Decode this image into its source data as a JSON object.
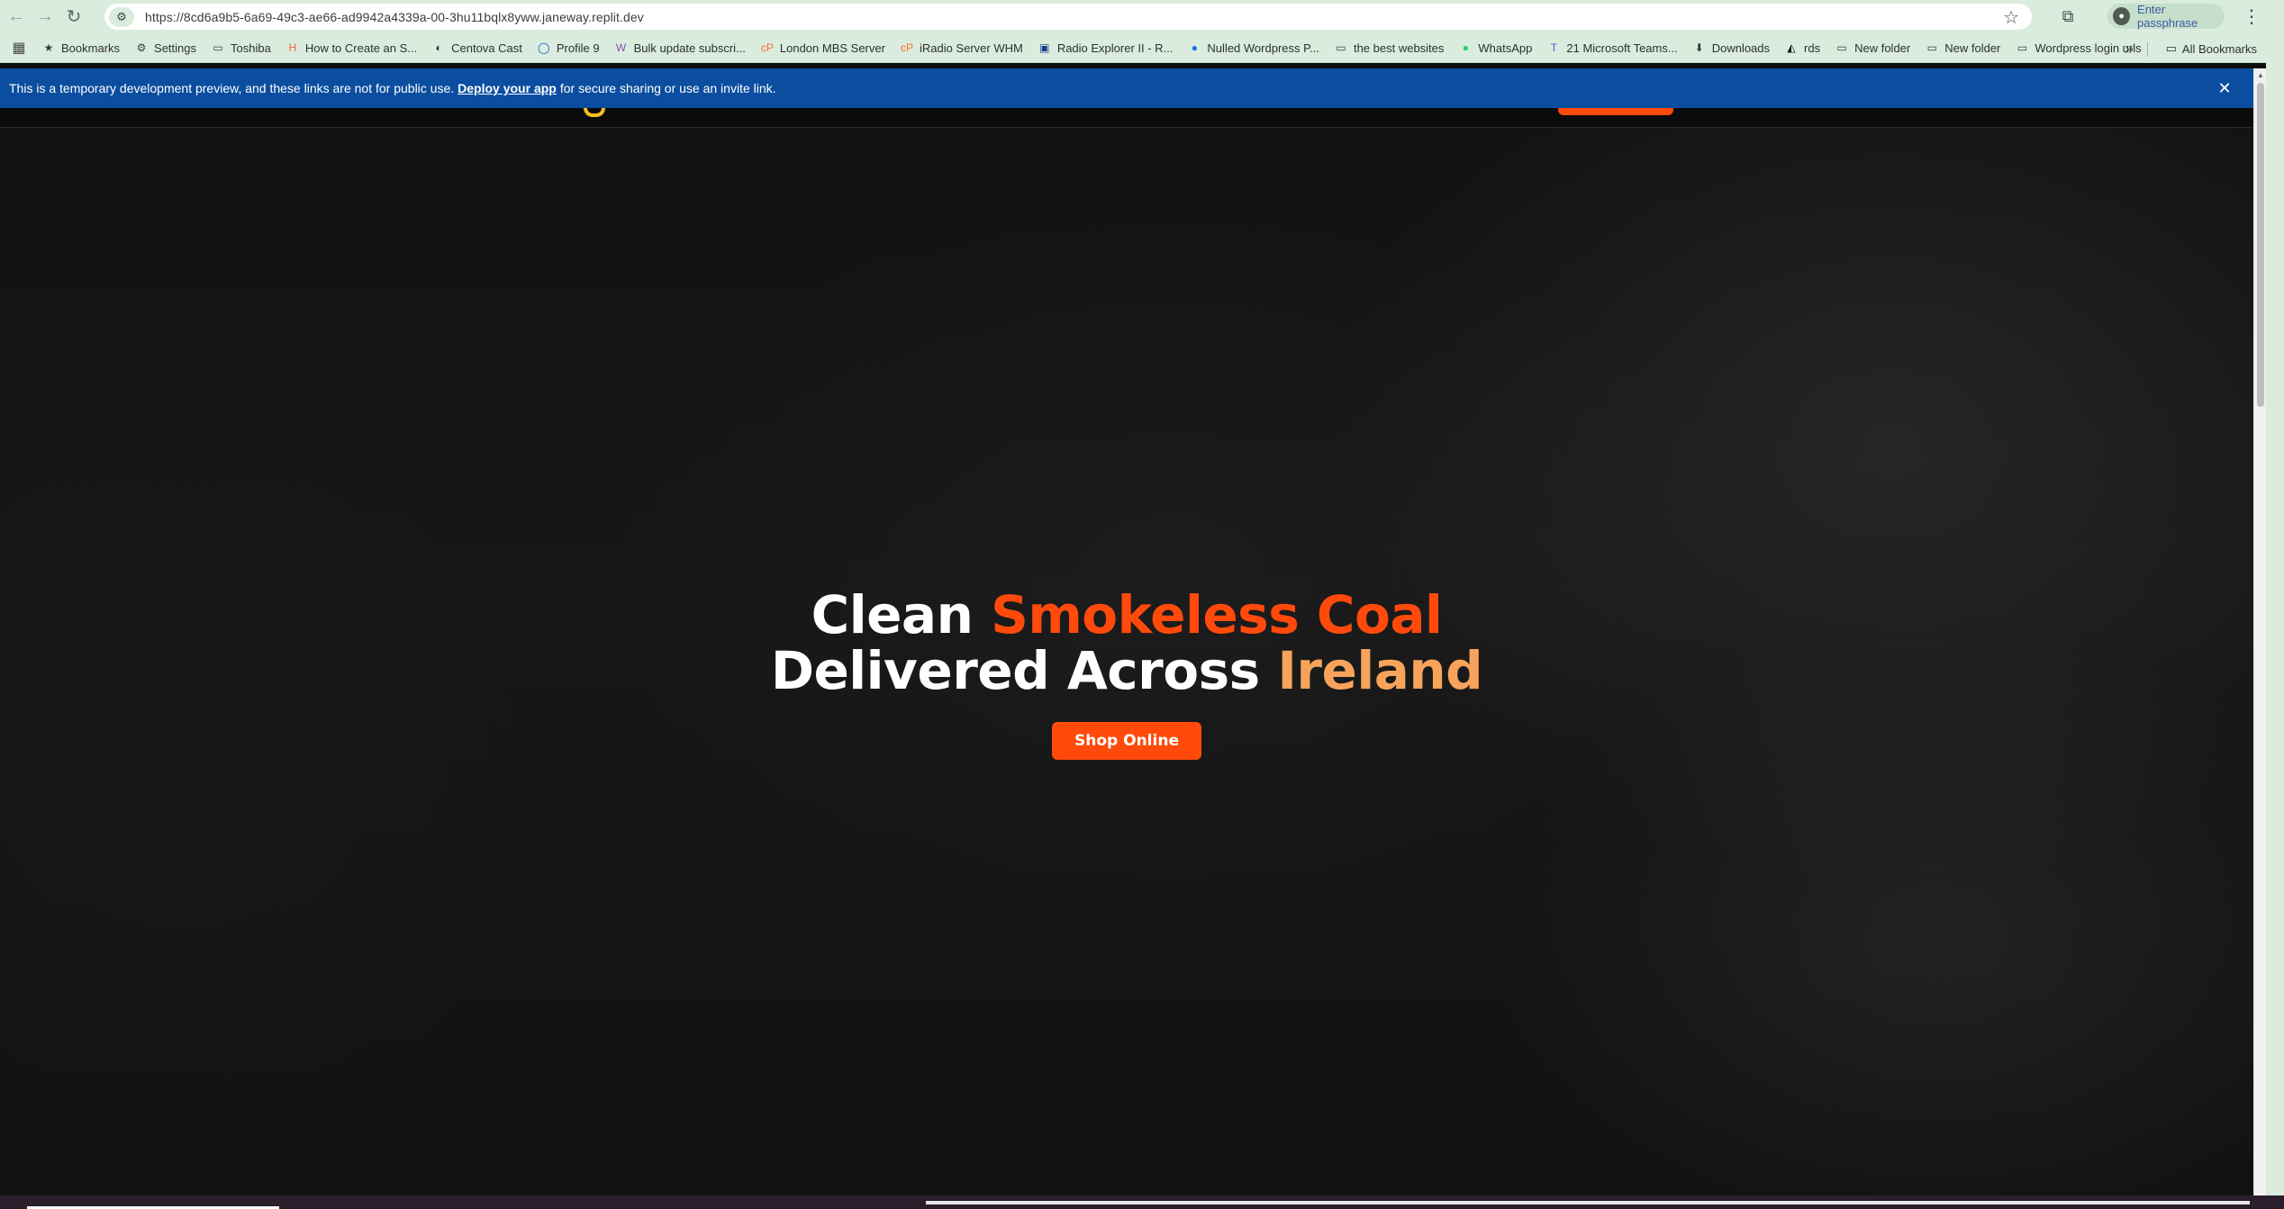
{
  "browser": {
    "url": "https://8cd6a9b5-6a69-49c3-ae66-ad9942a4339a-00-3hu11bqlx8yww.janeway.replit.dev",
    "profile_label": "Enter passphrase",
    "bookmarks": [
      {
        "label": "Bookmarks",
        "icon": "star-icon",
        "glyph": "★",
        "color": "#3a3a3a"
      },
      {
        "label": "Settings",
        "icon": "gear-icon",
        "glyph": "⚙",
        "color": "#3a3a3a"
      },
      {
        "label": "Toshiba",
        "icon": "folder-icon",
        "glyph": "▭",
        "color": "#3a3a3a"
      },
      {
        "label": "How to Create an S...",
        "icon": "hubspot-icon",
        "glyph": "H",
        "color": "#ff5c35"
      },
      {
        "label": "Centova Cast",
        "icon": "centova-icon",
        "glyph": "◐",
        "color": "#333333"
      },
      {
        "label": "Profile 9",
        "icon": "profile-icon",
        "glyph": "◯",
        "color": "#1a56db"
      },
      {
        "label": "Bulk update subscri...",
        "icon": "woo-icon",
        "glyph": "W",
        "color": "#7f54b3"
      },
      {
        "label": "London MBS Server",
        "icon": "cpanel-icon",
        "glyph": "cP",
        "color": "#ff6c2c"
      },
      {
        "label": "iRadio Server WHM",
        "icon": "cpanel-icon",
        "glyph": "cP",
        "color": "#ff6c2c"
      },
      {
        "label": "Radio Explorer II - R...",
        "icon": "radio-icon",
        "glyph": "▣",
        "color": "#1c3d8f"
      },
      {
        "label": "Nulled Wordpress P...",
        "icon": "globe-icon",
        "glyph": "●",
        "color": "#1a73e8"
      },
      {
        "label": "the best websites",
        "icon": "folder-icon",
        "glyph": "▭",
        "color": "#3a3a3a"
      },
      {
        "label": "WhatsApp",
        "icon": "whatsapp-icon",
        "glyph": "●",
        "color": "#25d366"
      },
      {
        "label": "21 Microsoft Teams...",
        "icon": "teams-icon",
        "glyph": "T",
        "color": "#5b5fc7"
      },
      {
        "label": "Downloads",
        "icon": "download-icon",
        "glyph": "⬇",
        "color": "#3a3a3a"
      },
      {
        "label": "rds",
        "icon": "rds-icon",
        "glyph": "◭",
        "color": "#111111"
      },
      {
        "label": "New folder",
        "icon": "folder-icon",
        "glyph": "▭",
        "color": "#3a3a3a"
      },
      {
        "label": "New folder",
        "icon": "folder-icon",
        "glyph": "▭",
        "color": "#3a3a3a"
      },
      {
        "label": "Wordpress login urls",
        "icon": "folder-icon",
        "glyph": "▭",
        "color": "#3a3a3a"
      }
    ],
    "all_bookmarks_label": "All Bookmarks"
  },
  "banner": {
    "text_before": "This is a temporary development preview, and these links are not for public use.",
    "link_label": "Deploy your app",
    "text_after": "for secure sharing or use an invite link.",
    "close_glyph": "✕"
  },
  "hero": {
    "title_part1": "Clean",
    "title_highlight1": "Smokeless Coal",
    "title_part2": "Delivered Across",
    "title_highlight2": "Ireland",
    "cta_label": "Shop Online"
  },
  "colors": {
    "accent_orange": "#ff4a0b",
    "accent_amber": "#f7a35c",
    "banner_blue": "#0b4ea0",
    "logo_yellow": "#f3c21b"
  }
}
